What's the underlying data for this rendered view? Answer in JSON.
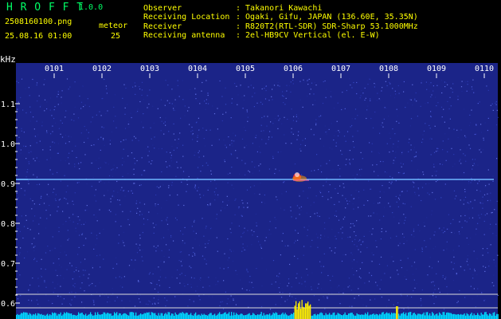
{
  "app": {
    "name": "H R O F F T",
    "version": "1.0.0"
  },
  "file": {
    "name": "2508160100.png",
    "datetime": "25.08.16 01:00"
  },
  "counter": {
    "label": "meteor",
    "value": "25"
  },
  "station": [
    {
      "key": "Observer",
      "value": ": Takanori Kawachi"
    },
    {
      "key": "Receiving Location",
      "value": ": Ogaki, Gifu, JAPAN (136.60E, 35.35N)"
    },
    {
      "key": "Receiver",
      "value": ": R820T2(RTL-SDR) SDR-Sharp 53.1000MHz"
    },
    {
      "key": "Receiving antenna",
      "value": ": 2el-HB9CV Vertical (el. E-W)"
    }
  ],
  "chart_data": {
    "type": "heatmap",
    "y_unit": "kHz",
    "x_ticks": [
      "0101",
      "0102",
      "0103",
      "0104",
      "0105",
      "0106",
      "0107",
      "0108",
      "0109",
      "0110"
    ],
    "y_ticks": [
      "1.1",
      "1.0",
      "0.9",
      "0.8",
      "0.7",
      "0.6"
    ],
    "carrier_khz": 0.91,
    "meteor_minute": "0106",
    "colors": {
      "background": "#1b2488",
      "trace": "#6fb8ff",
      "tick": "#ffffff",
      "level": "#00d8ff",
      "burst": "#ffee00"
    }
  }
}
